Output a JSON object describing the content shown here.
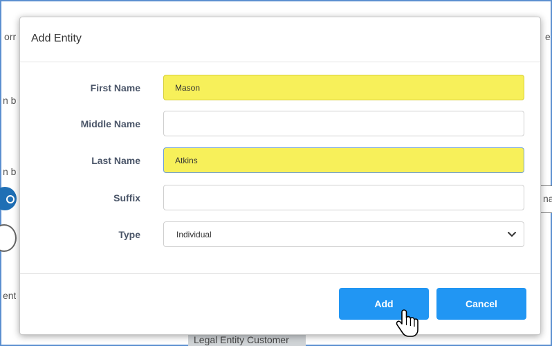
{
  "background": {
    "fragments": {
      "top_left": "orr",
      "top_right": "e",
      "left_1": "n b",
      "left_2": "n b",
      "left_bottom": "ent",
      "right_box": "na"
    },
    "legal_label": "Legal Entity Customer"
  },
  "modal": {
    "title": "Add Entity",
    "fields": {
      "first_name": {
        "label": "First Name",
        "value": "Mason"
      },
      "middle_name": {
        "label": "Middle Name",
        "value": ""
      },
      "last_name": {
        "label": "Last Name",
        "value": "Atkins"
      },
      "suffix": {
        "label": "Suffix",
        "value": ""
      },
      "type": {
        "label": "Type",
        "value": "Individual"
      }
    },
    "buttons": {
      "add": "Add",
      "cancel": "Cancel"
    }
  },
  "colors": {
    "primary_button": "#2196f3",
    "highlight": "#f7f05a",
    "frame_border": "#5b8fd0"
  },
  "icons": {
    "select_chevron": "chevron-down-icon",
    "cursor": "hand-pointer-icon"
  }
}
